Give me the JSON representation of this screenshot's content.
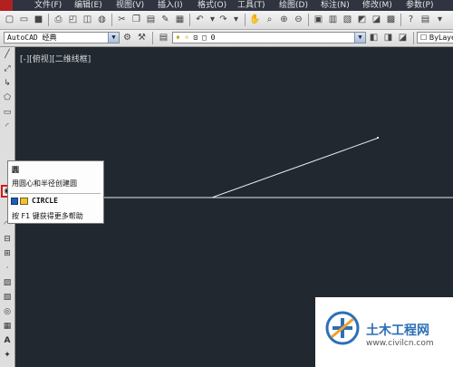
{
  "menubar": {
    "items": [
      "文件(F)",
      "编辑(E)",
      "视图(V)",
      "插入(I)",
      "格式(O)",
      "工具(T)",
      "绘图(D)",
      "标注(N)",
      "修改(M)",
      "参数(P)"
    ]
  },
  "toolbar": {
    "workspace_value": "AutoCAD 经典",
    "layer_value": "0",
    "linetype_value": "ByLaye"
  },
  "viewport": {
    "label": "[-][俯视][二维线框]"
  },
  "tooltip": {
    "title": "圆",
    "description": "用圆心和半径创建圆",
    "command": "CIRCLE",
    "help": "按 F1 键获得更多帮助"
  },
  "watermark": {
    "title": "土木工程网",
    "url": "www.civilcn.com",
    "logo_color": "#2c6fb7"
  },
  "icons": {
    "palette": [
      "line-icon",
      "construction-line-icon",
      "polyline-icon",
      "polygon-icon",
      "rectangle-icon",
      "arc-icon",
      "circle-icon",
      "revision-cloud-icon",
      "spline-icon",
      "ellipse-icon",
      "ellipse-arc-icon",
      "insert-block-icon",
      "make-block-icon",
      "point-icon",
      "hatch-icon",
      "gradient-icon",
      "region-icon",
      "table-icon",
      "multiline-text-icon",
      "add-selected-icon"
    ]
  },
  "colors": {
    "canvas": "#212830",
    "menubar": "#2f3440",
    "highlight": "#d71515",
    "line": "#e8e8e8"
  }
}
